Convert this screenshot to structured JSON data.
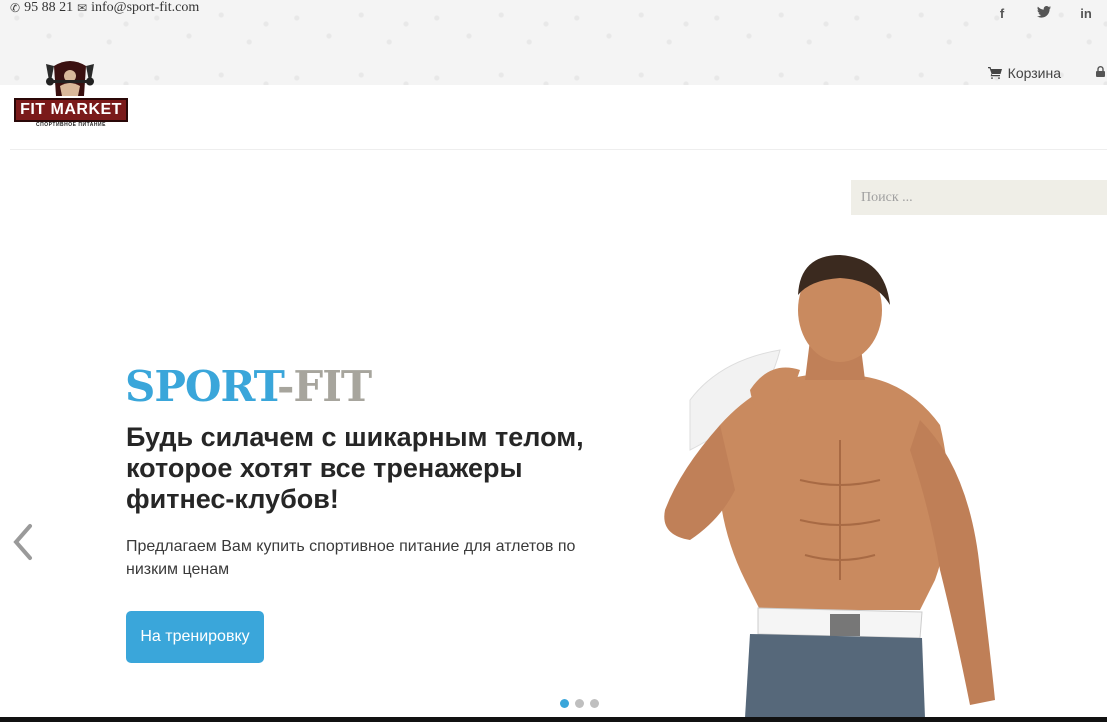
{
  "topbar": {
    "phone": "95 88 21",
    "email": "info@sport-fit.com",
    "social": [
      "f",
      "t",
      "in"
    ],
    "cart_label": "Корзина"
  },
  "logo": {
    "word": "FIT MARKET",
    "tagline": "СПОРТИВНОЕ ПИТАНИЕ"
  },
  "search": {
    "placeholder": "Поиск ..."
  },
  "hero": {
    "title_part1": "SPORT",
    "title_part2": "-FIT",
    "heading": "Будь силачем с шикарным телом, которое хотят все тренажеры фитнес-клубов!",
    "text": "Предлагаем Вам купить спортивное питание для атлетов по низким ценам",
    "button_label": "На тренировку"
  },
  "slider": {
    "total_slides": 3,
    "active_slide": 1
  },
  "colors": {
    "accent": "#3aa6da",
    "title_gray": "#a7a59d",
    "logo_red": "#7a1a1a"
  }
}
